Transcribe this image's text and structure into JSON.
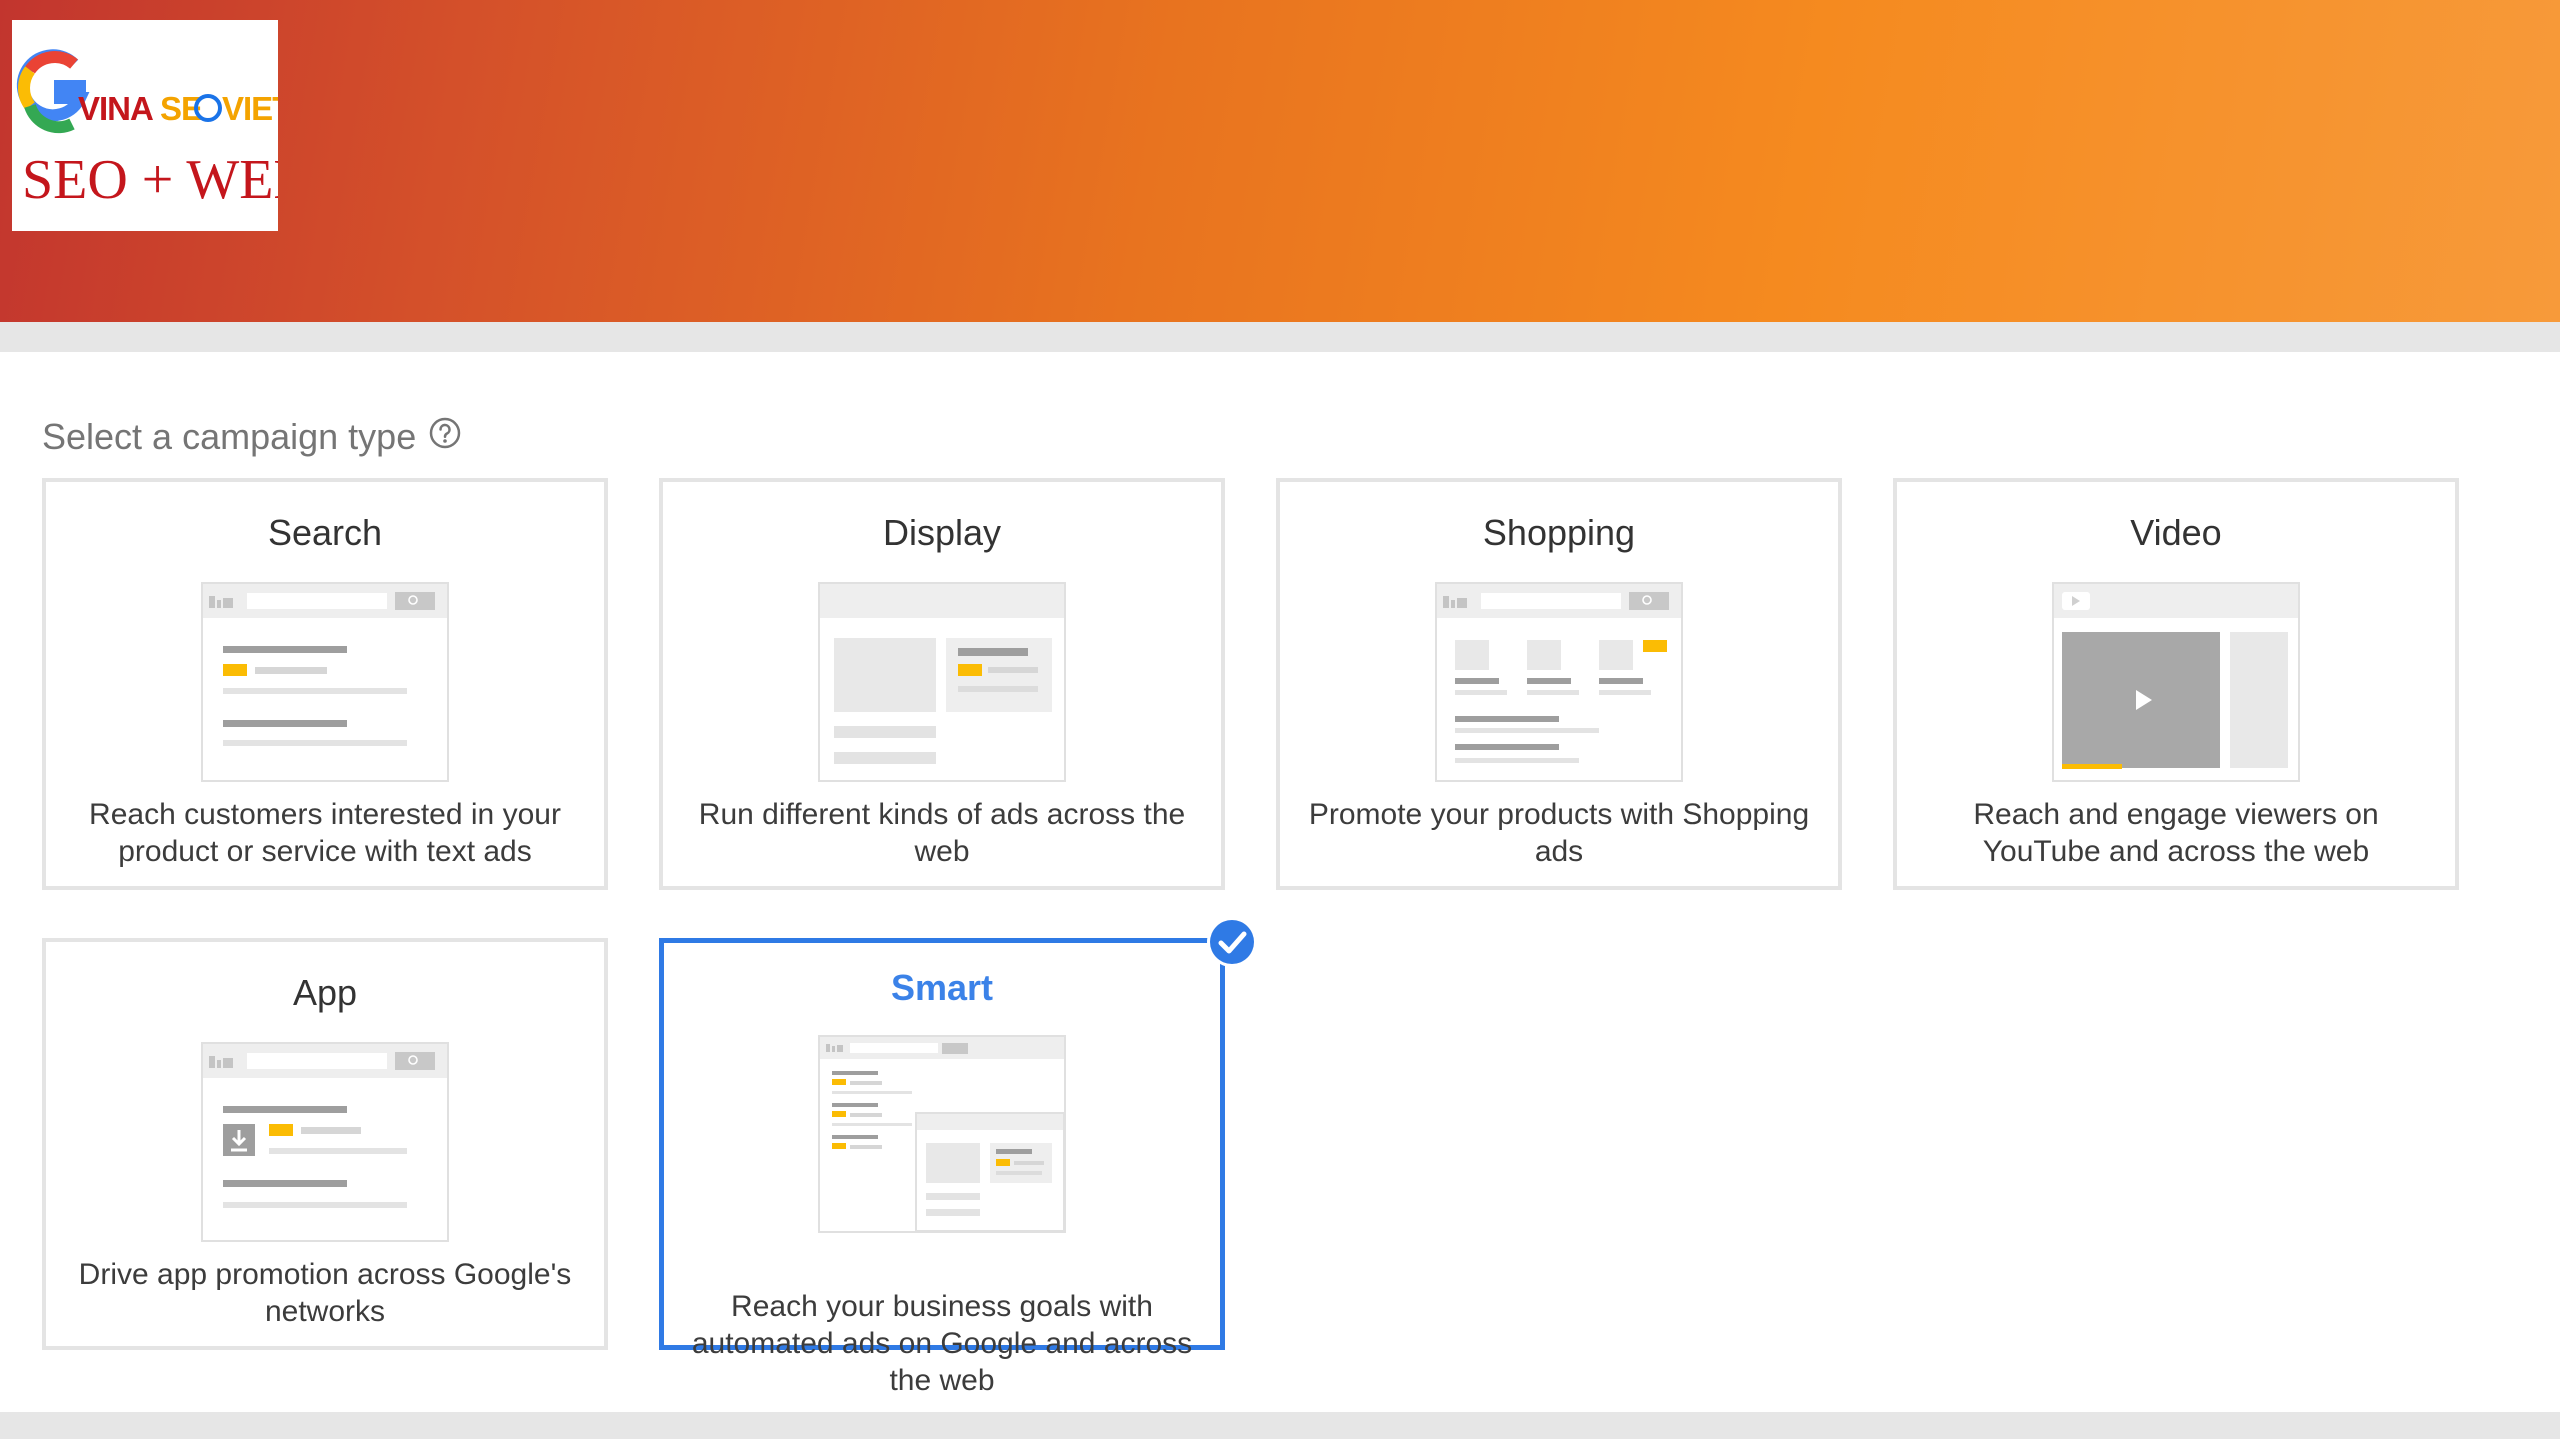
{
  "logo": {
    "brand_text": "VINASEOVIET",
    "tagline": "SEO + WEB"
  },
  "header": {
    "title": "Select a campaign type",
    "help_icon": "help-circle-icon"
  },
  "campaign_types": [
    {
      "title": "Search",
      "description": "Reach customers interested in your product or service with text ads",
      "icon": "search-ad-illustration"
    },
    {
      "title": "Display",
      "description": "Run different kinds of ads across the web",
      "icon": "display-ad-illustration"
    },
    {
      "title": "Shopping",
      "description": "Promote your products with Shopping ads",
      "icon": "shopping-ad-illustration"
    },
    {
      "title": "Video",
      "description": "Reach and engage viewers on YouTube and across the web",
      "icon": "video-ad-illustration"
    },
    {
      "title": "App",
      "description": "Drive app promotion across Google's networks",
      "icon": "app-ad-illustration"
    },
    {
      "title": "Smart",
      "description": "Reach your business goals with automated ads on Google and across the web",
      "icon": "smart-ad-illustration",
      "selected": true
    }
  ],
  "colors": {
    "accent": "#2f7ae5",
    "highlight": "#fbbc04",
    "banner_start": "#c2352e",
    "banner_end": "#f79a3a"
  }
}
